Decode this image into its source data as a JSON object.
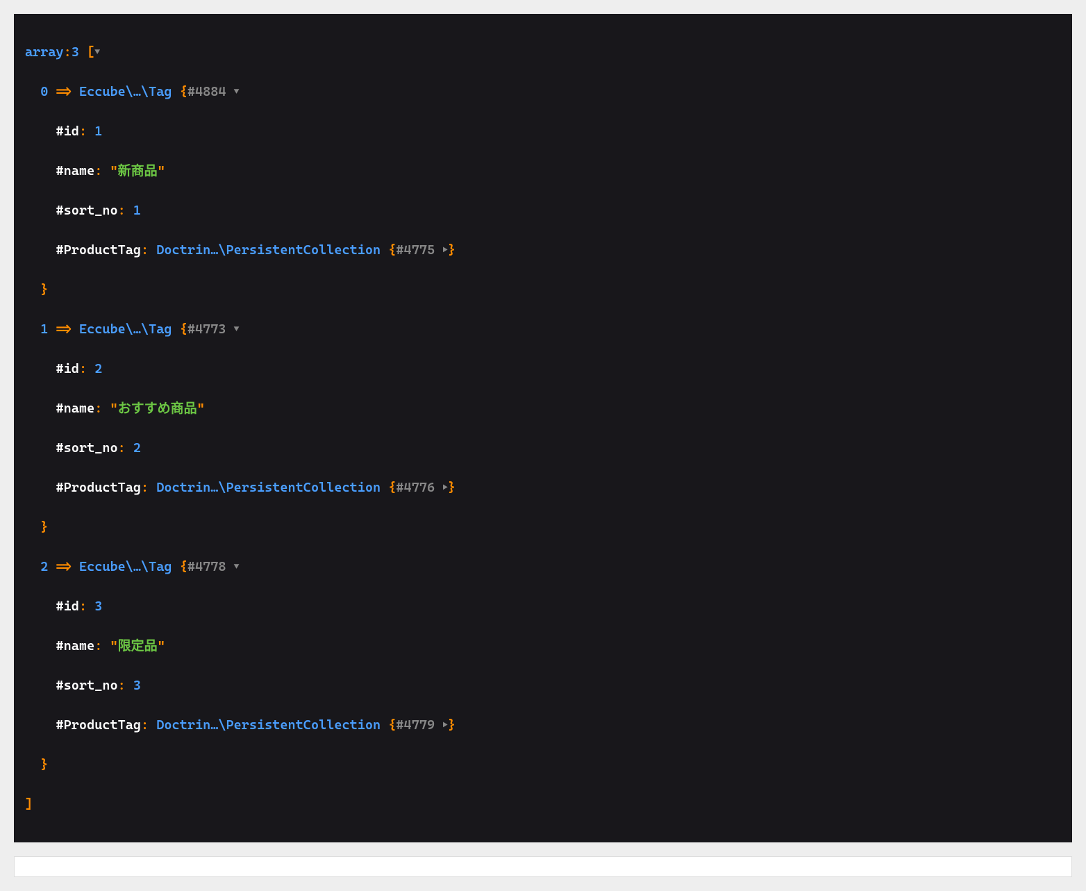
{
  "dump": {
    "type": "array",
    "count": "3",
    "items": [
      {
        "index": "0",
        "class": "Eccube\\…\\Tag",
        "objectId": "#4884",
        "props": {
          "id": "1",
          "name": "新商品",
          "sort_no": "1",
          "productTag": {
            "class": "Doctrin…\\PersistentCollection",
            "objectId": "#4775"
          }
        }
      },
      {
        "index": "1",
        "class": "Eccube\\…\\Tag",
        "objectId": "#4773",
        "props": {
          "id": "2",
          "name": "おすすめ商品",
          "sort_no": "2",
          "productTag": {
            "class": "Doctrin…\\PersistentCollection",
            "objectId": "#4776"
          }
        }
      },
      {
        "index": "2",
        "class": "Eccube\\…\\Tag",
        "objectId": "#4778",
        "props": {
          "id": "3",
          "name": "限定品",
          "sort_no": "3",
          "productTag": {
            "class": "Doctrin…\\PersistentCollection",
            "objectId": "#4779"
          }
        }
      }
    ]
  },
  "labels": {
    "propId": "#id",
    "propName": "#name",
    "propSortNo": "#sort_no",
    "propProductTag": "#ProductTag",
    "arrow": "=>"
  }
}
